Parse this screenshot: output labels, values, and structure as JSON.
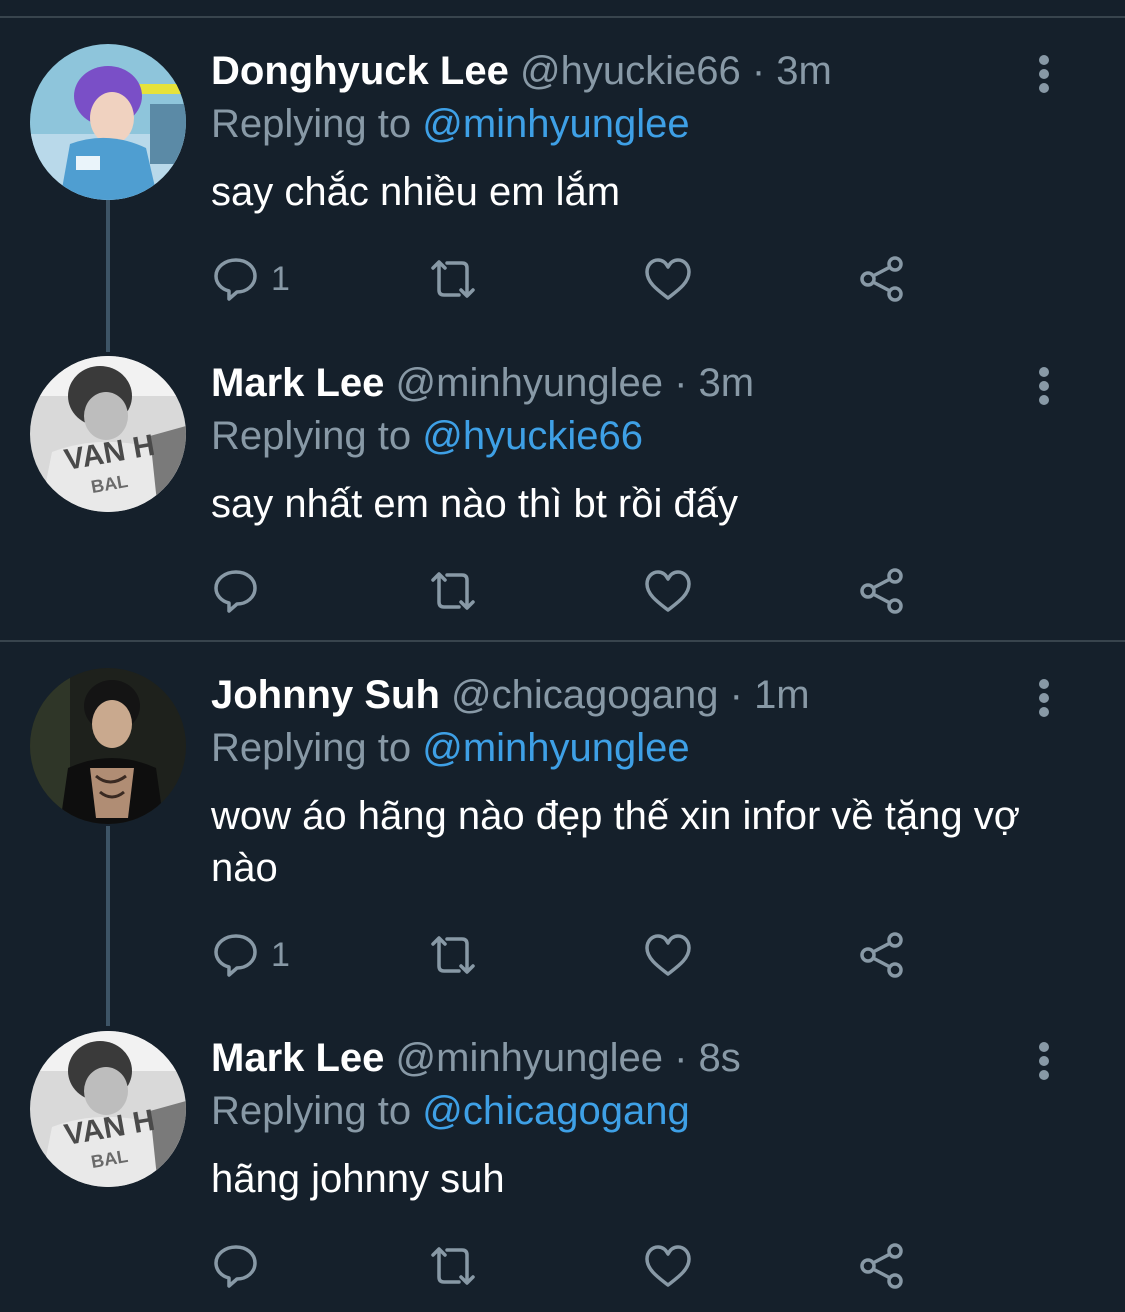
{
  "tweets": [
    {
      "name": "Donghyuck Lee",
      "handle": "@hyuckie66",
      "separator": "·",
      "time": "3m",
      "replying_prefix": "Replying to ",
      "replying_to": "@minhyunglee",
      "text": "say chắc nhiều em lắm",
      "reply_count": "1"
    },
    {
      "name": "Mark Lee",
      "handle": "@minhyunglee",
      "separator": "·",
      "time": "3m",
      "replying_prefix": "Replying to ",
      "replying_to": "@hyuckie66",
      "text": "say nhất em nào thì bt rồi đấy",
      "reply_count": ""
    },
    {
      "name": "Johnny Suh",
      "handle": "@chicagogang",
      "separator": "·",
      "time": "1m",
      "replying_prefix": "Replying to ",
      "replying_to": "@minhyunglee",
      "text": "wow áo hãng nào đẹp thế xin infor về tặng vợ nào",
      "reply_count": "1"
    },
    {
      "name": "Mark Lee",
      "handle": "@minhyunglee",
      "separator": "·",
      "time": "8s",
      "replying_prefix": "Replying to ",
      "replying_to": "@chicagogang",
      "text": "hãng johnny suh",
      "reply_count": ""
    }
  ],
  "icons": {
    "reply": "reply-icon",
    "retweet": "retweet-icon",
    "like": "like-icon",
    "share": "share-icon",
    "more": "more-icon"
  },
  "colors": {
    "background": "#15202b",
    "secondary_text": "#8899a6",
    "mention": "#3ea0e6",
    "divider": "#38444d"
  }
}
